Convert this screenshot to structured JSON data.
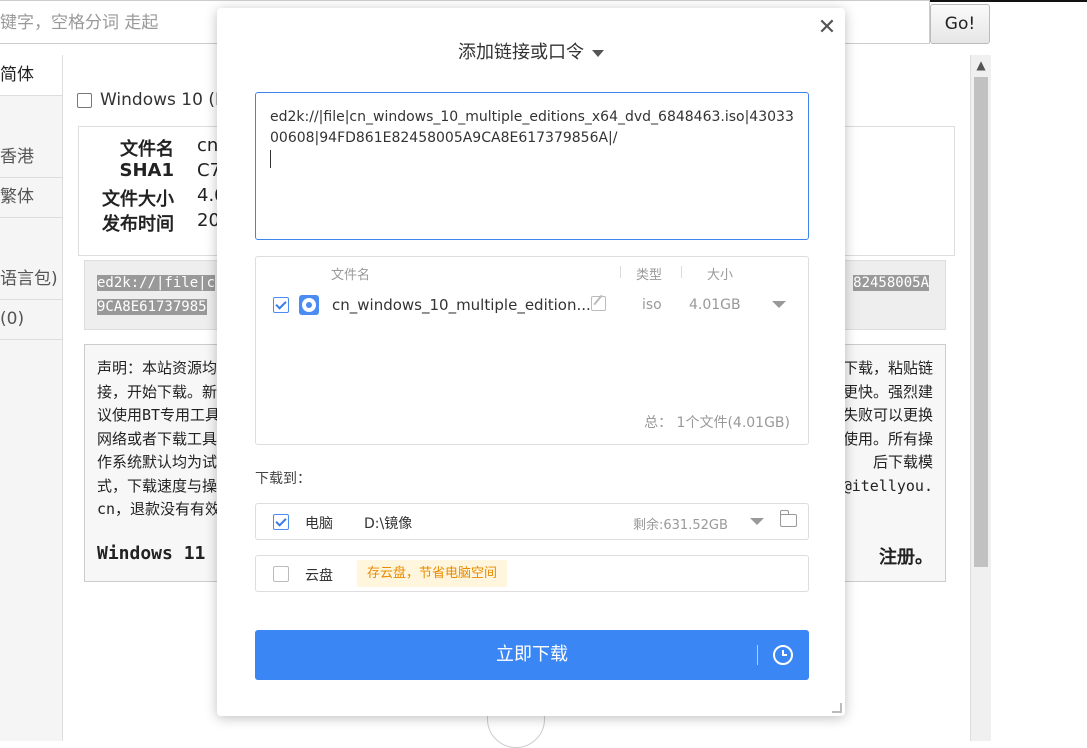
{
  "background": {
    "search_placeholder": "键字，空格分词 走起",
    "go_label": "Go!",
    "nav": [
      "简体",
      "香港",
      "繁体",
      "语言包)",
      "(0)"
    ],
    "item_title": "Windows 10 (M",
    "info": {
      "labels": [
        "文件名",
        "SHA1",
        "文件大小",
        "发布时间"
      ],
      "values": [
        "cn_",
        "C7",
        "4.0",
        "20"
      ]
    },
    "link_lines": [
      "ed2k://|file|c",
      "9CA8E61737985",
      "82458005A"
    ],
    "notice_lines_left": [
      "声明：本站资源均",
      "接，开始下载。新",
      "议使用BT专用工具",
      "网络或者下载工具",
      "作系统默认均为试",
      "式，下载速度与操",
      "cn，退款没有有效"
    ],
    "notice_lines_right": [
      "下载，粘贴链",
      "更快。强烈建",
      "失败可以更换",
      "使用。所有操",
      "后下载模",
      "@itellyou.",
      ""
    ],
    "notice_strong_left": "Windows 11",
    "notice_strong_right": "注册。"
  },
  "modal": {
    "title": "添加链接或口令",
    "close_icon": "close-icon",
    "link_input_value": "ed2k://|file|cn_windows_10_multiple_editions_x64_dvd_6848463.iso|4303300608|94FD861E82458005A9CA8E617379856A|/",
    "file_table": {
      "headers": [
        "文件名",
        "类型",
        "大小"
      ],
      "rows": [
        {
          "checked": true,
          "name": "cn_windows_10_multiple_edition...",
          "type": "iso",
          "size": "4.01GB"
        }
      ],
      "summary": "总： 1个文件(4.01GB)"
    },
    "download_to_label": "下载到：",
    "local": {
      "checked": true,
      "label": "电脑",
      "path": "D:\\镜像",
      "free": "剩余:631.52GB"
    },
    "cloud": {
      "checked": false,
      "label": "云盘",
      "tag": "存云盘，节省电脑空间"
    },
    "download_button": "立即下载",
    "accent_color": "#3b86f5",
    "tag_color": "#e98a00"
  }
}
